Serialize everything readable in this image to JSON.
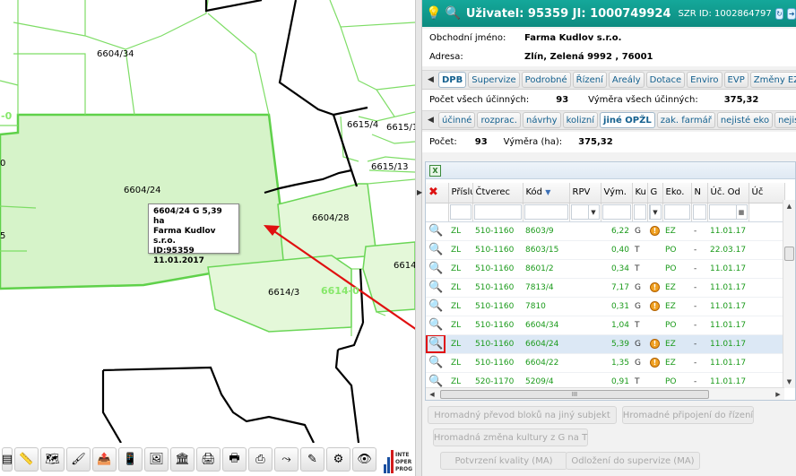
{
  "map": {
    "parcels": [
      "6604/34",
      "6604/24",
      "6604/28",
      "6614/3",
      "6615/4",
      "6615/1",
      "6615/13",
      "6614"
    ],
    "zone_labels": [
      "6614-0",
      "-0"
    ],
    "edge_labels": [
      "0",
      "5"
    ],
    "tooltip": [
      "6604/24 G 5,39 ha",
      "Farma Kudlov s.r.o.",
      "ID:95359",
      "11.01.2017"
    ]
  },
  "toolbar": {
    "icons": [
      "layers-icon",
      "ruler-icon",
      "parcel-icon",
      "brush-icon",
      "export-icon",
      "device-icon",
      "image-edit-icon",
      "building-icon",
      "print-icon",
      "print-preview-icon",
      "print-red-icon",
      "route-icon",
      "marker-icon",
      "settings-icon",
      "eye-icon"
    ],
    "logo_lines": [
      "INTE",
      "OPER",
      "PROG"
    ]
  },
  "header": {
    "user": "Uživatel: 95359 JI: 1000749924",
    "szr": "SZR ID: 1002864797"
  },
  "info": {
    "name_label": "Obchodní jméno:",
    "name_value": "Farma Kudlov s.r.o.",
    "addr_label": "Adresa:",
    "addr_value": "Zlín, Zelená 9992 , 76001"
  },
  "tabs1": [
    "DPB",
    "Supervize",
    "Podrobné",
    "Řízení",
    "Areály",
    "Dotace",
    "Enviro",
    "EVP",
    "Změny EZ"
  ],
  "summary1": {
    "count_label": "Počet všech účinných:",
    "count_value": "93",
    "area_label": "Výměra všech účinných:",
    "area_value": "375,32"
  },
  "tabs2": [
    "účinné",
    "rozprac.",
    "návrhy",
    "kolizní",
    "jiné OPŽL",
    "zak. farmář",
    "nejisté eko",
    "nejist"
  ],
  "summary2": {
    "count_label": "Počet:",
    "count_value": "93",
    "area_label": "Výměra (ha):",
    "area_value": "375,32"
  },
  "grid": {
    "columns": [
      "Příslu",
      "Čtverec",
      "Kód",
      "RPV",
      "Vým.",
      "Ku",
      "G",
      "Eko.",
      "N",
      "Úč. Od",
      "Úč"
    ],
    "rows": [
      [
        "ZL",
        "510-1160",
        "8603/9",
        "",
        "6,22",
        "G",
        "!",
        "EZ",
        "-",
        "11.01.17"
      ],
      [
        "ZL",
        "510-1160",
        "8603/15",
        "",
        "0,40",
        "T",
        "",
        "PO",
        "-",
        "22.03.17"
      ],
      [
        "ZL",
        "510-1160",
        "8601/2",
        "",
        "0,34",
        "T",
        "",
        "PO",
        "-",
        "11.01.17"
      ],
      [
        "ZL",
        "510-1160",
        "7813/4",
        "",
        "7,17",
        "G",
        "!",
        "EZ",
        "-",
        "11.01.17"
      ],
      [
        "ZL",
        "510-1160",
        "7810",
        "",
        "0,31",
        "G",
        "!",
        "EZ",
        "-",
        "11.01.17"
      ],
      [
        "ZL",
        "510-1160",
        "6604/34",
        "",
        "1,04",
        "T",
        "",
        "PO",
        "-",
        "11.01.17"
      ],
      [
        "ZL",
        "510-1160",
        "6604/24",
        "",
        "5,39",
        "G",
        "!",
        "EZ",
        "-",
        "11.01.17"
      ],
      [
        "ZL",
        "510-1160",
        "6604/22",
        "",
        "1,35",
        "G",
        "!",
        "EZ",
        "-",
        "11.01.17"
      ],
      [
        "ZL",
        "520-1170",
        "5209/4",
        "",
        "0,91",
        "T",
        "",
        "PO",
        "-",
        "11.01.17"
      ]
    ],
    "hscroll_mark": "III"
  },
  "actions": {
    "b1": "Hromadný převod bloků na jiný subjekt",
    "b2": "Hromadné připojení do řízení",
    "b3": "Hromadná změna kultury z G na T",
    "b4": "Potvrzení kvality (MA)",
    "b5": "Odložení do supervize (MA)"
  }
}
